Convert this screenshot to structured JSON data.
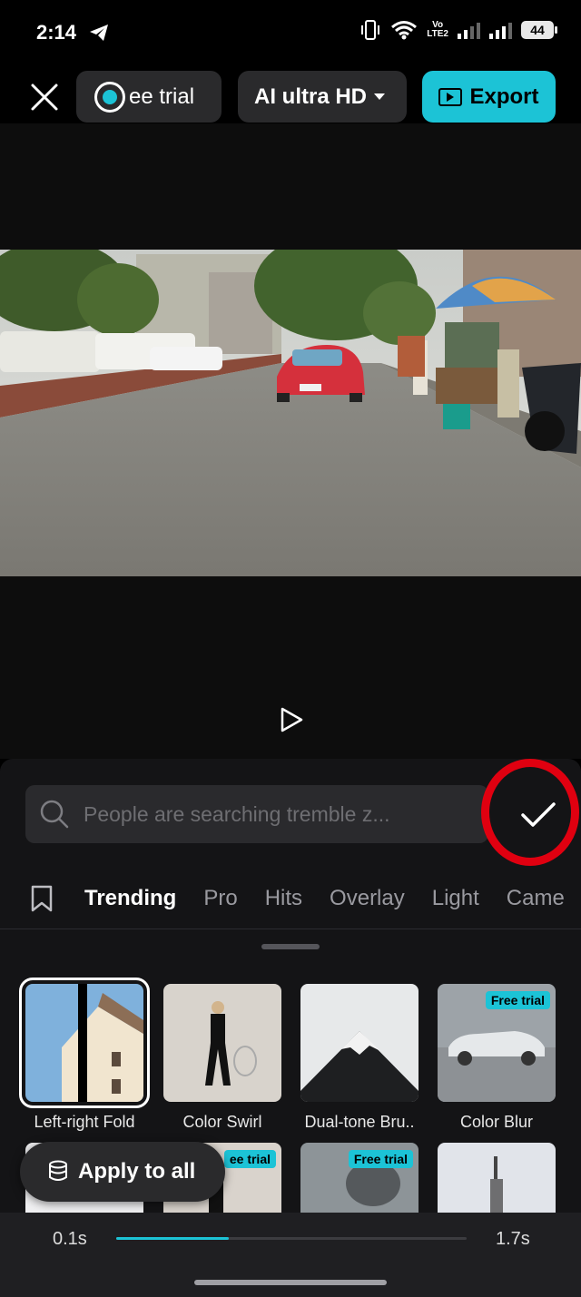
{
  "status_bar": {
    "time": "2:14",
    "network_label_top": "Vo",
    "network_label_bottom": "LTE2",
    "battery": "44",
    "icons": [
      "telegram-icon",
      "vibrate-icon",
      "wifi-icon",
      "signal-icon",
      "battery-icon"
    ]
  },
  "toolbar": {
    "trial_label": "ee trial",
    "quality_label": "AI ultra HD",
    "export_label": "Export",
    "accent_color": "#1cc3d6"
  },
  "search": {
    "placeholder": "People are searching tremble z..."
  },
  "tabs": [
    {
      "label": "Trending",
      "active": true
    },
    {
      "label": "Pro",
      "active": false
    },
    {
      "label": "Hits",
      "active": false
    },
    {
      "label": "Overlay",
      "active": false
    },
    {
      "label": "Light",
      "active": false
    },
    {
      "label": "Came",
      "active": false
    }
  ],
  "effects": [
    {
      "label": "Left-right Fold",
      "badge": "",
      "selected": true
    },
    {
      "label": "Color Swirl",
      "badge": "",
      "selected": false
    },
    {
      "label": "Dual-tone Bru..",
      "badge": "",
      "selected": false
    },
    {
      "label": "Color Blur",
      "badge": "Free trial",
      "selected": false
    }
  ],
  "effects_row2_badges": [
    "ee trial",
    "Free trial"
  ],
  "apply_all_label": "Apply to all",
  "duration": {
    "min": "0.1s",
    "max": "1.7s",
    "fill_fraction": 0.32
  },
  "highlight_color": "#e00010"
}
